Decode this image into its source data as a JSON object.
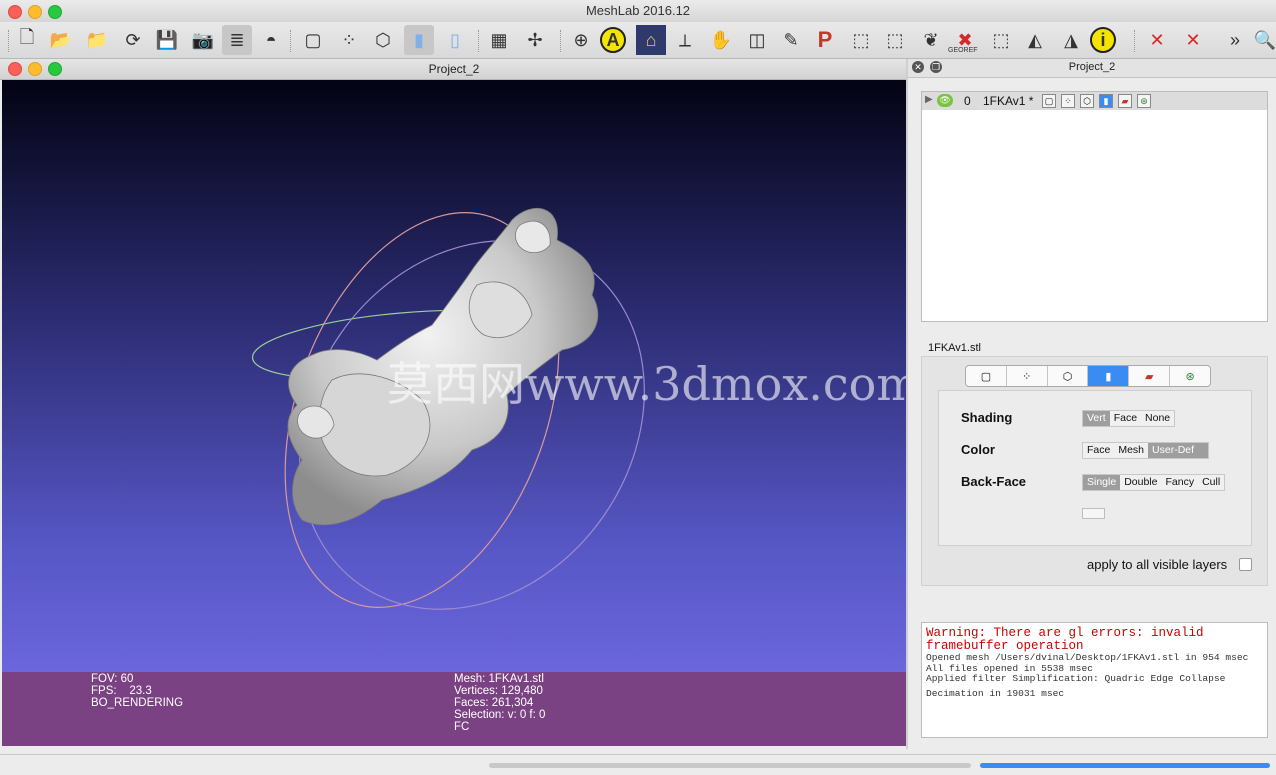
{
  "app": {
    "title": "MeshLab 2016.12"
  },
  "toolbar": {
    "buttons": [
      {
        "icon": "new-project-icon",
        "glyph": "🗋"
      },
      {
        "icon": "open-project-icon",
        "glyph": "📂"
      },
      {
        "icon": "open-mesh-icon",
        "glyph": "📁"
      },
      {
        "icon": "reload-icon",
        "glyph": "⟳"
      },
      {
        "icon": "save-icon",
        "glyph": "💾"
      },
      {
        "icon": "snapshot-icon",
        "glyph": "📷"
      },
      {
        "icon": "layers-icon",
        "glyph": "≣"
      },
      {
        "icon": "raster-icon",
        "glyph": "◓"
      },
      {
        "icon": "bbox-icon",
        "glyph": "▢"
      },
      {
        "icon": "points-icon",
        "glyph": "⁘"
      },
      {
        "icon": "wireframe-icon",
        "glyph": "⬡"
      },
      {
        "icon": "smooth-icon",
        "glyph": "▮"
      },
      {
        "icon": "flat-icon",
        "glyph": "▯"
      },
      {
        "icon": "grid-icon",
        "glyph": "▦"
      },
      {
        "icon": "axes-icon",
        "glyph": "✢"
      },
      {
        "icon": "trackball-icon",
        "glyph": "⊕"
      },
      {
        "icon": "annotate-icon",
        "glyph": "A"
      },
      {
        "icon": "museum-icon",
        "glyph": "⌂"
      },
      {
        "icon": "measure-icon",
        "glyph": "⟂"
      },
      {
        "icon": "hand-icon",
        "glyph": "✋"
      },
      {
        "icon": "raster-align-icon",
        "glyph": "◫"
      },
      {
        "icon": "paint-icon",
        "glyph": "✎"
      },
      {
        "icon": "pp-icon",
        "glyph": "P"
      },
      {
        "icon": "select-faces-icon",
        "glyph": "⬚"
      },
      {
        "icon": "select-vertices-icon",
        "glyph": "⬚"
      },
      {
        "icon": "bunny-icon",
        "glyph": "❦"
      },
      {
        "icon": "georef-icon",
        "glyph": "✖"
      },
      {
        "icon": "rect-select-icon",
        "glyph": "⬚"
      },
      {
        "icon": "select-conn-icon",
        "glyph": "◭"
      },
      {
        "icon": "select-z-icon",
        "glyph": "◮"
      },
      {
        "icon": "info-icon",
        "glyph": "i"
      },
      {
        "icon": "delete-faces-icon",
        "glyph": "✕"
      },
      {
        "icon": "delete-vertices-icon",
        "glyph": "✕"
      },
      {
        "icon": "more-icon",
        "glyph": "»"
      },
      {
        "icon": "search-icon",
        "glyph": "🔍"
      }
    ],
    "georef_label": "GEOREF"
  },
  "viewer": {
    "title": "Project_2",
    "watermark": "莫西网www.3dmox.com",
    "info_left": [
      "FOV: 60",
      "FPS:    23.3",
      "BO_RENDERING"
    ],
    "info_right": [
      "Mesh: 1FKAv1.stl",
      "Vertices: 129,480",
      "Faces: 261,304",
      "Selection: v: 0 f: 0",
      "FC"
    ]
  },
  "dock": {
    "title": "Project_2",
    "layer": {
      "index": "0",
      "name": "1FKAv1 *"
    },
    "mesh_file": "1FKAv1.stl",
    "tabs": [
      "bbox",
      "points",
      "wire",
      "solid",
      "texture",
      "dots"
    ],
    "shading": {
      "label": "Shading",
      "options": [
        "Vert",
        "Face",
        "None"
      ],
      "selected": "Vert"
    },
    "color": {
      "label": "Color",
      "options": [
        "Face",
        "Mesh",
        "User-Def"
      ],
      "selected": "User-Def"
    },
    "backface": {
      "label": "Back-Face",
      "options": [
        "Single",
        "Double",
        "Fancy",
        "Cull"
      ],
      "selected": "Single"
    },
    "apply_label": "apply to all visible layers"
  },
  "log": {
    "warning": "Warning: There are gl errors: invalid framebuffer operation",
    "messages": [
      "Opened mesh /Users/dvinal/Desktop/1FKAv1.stl in 954 msec",
      "All files opened in 5538 msec",
      "Applied filter Simplification: Quadric Edge Collapse",
      "Decimation in 19031 msec"
    ]
  }
}
